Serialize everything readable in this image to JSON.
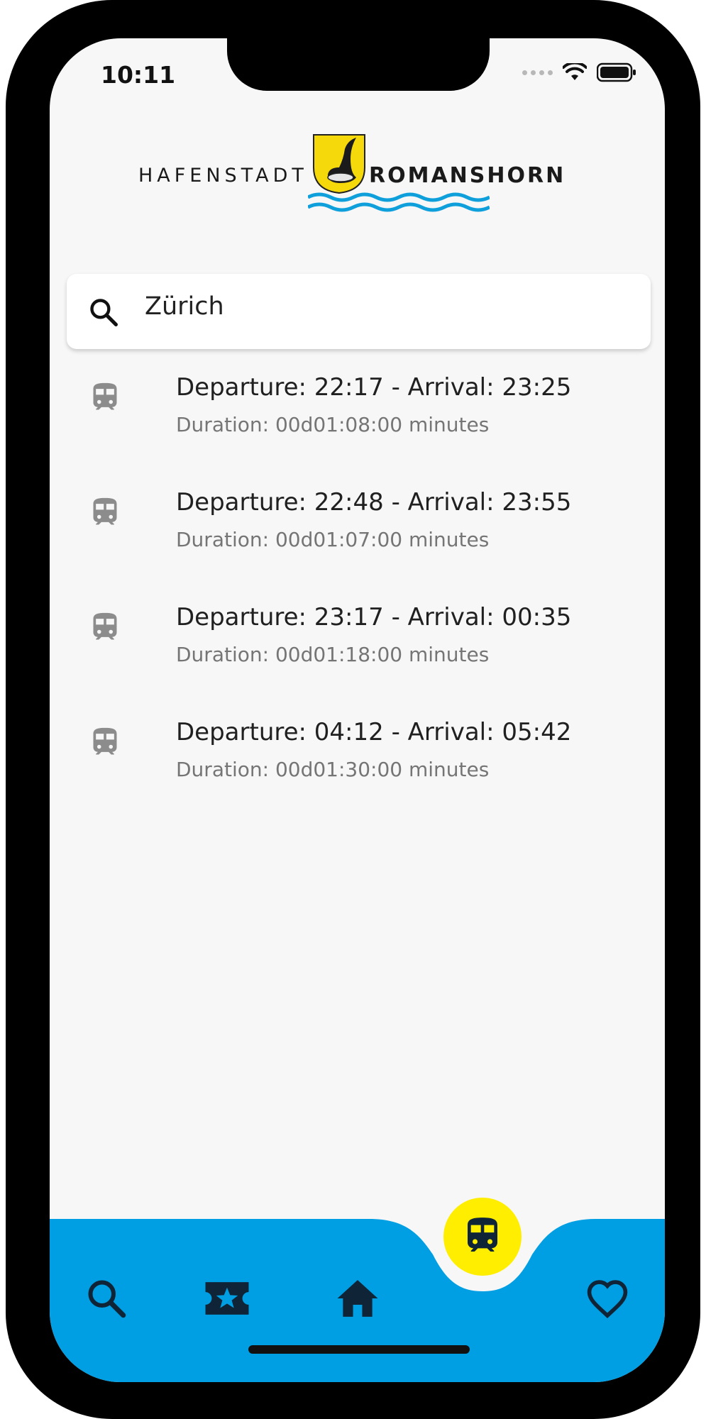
{
  "status_bar": {
    "time": "10:11"
  },
  "logo": {
    "left_text": "HAFENSTADT",
    "right_text": "ROMANSHORN",
    "crest_color": "#f5d90a",
    "wave_color": "#0fa0dc"
  },
  "search": {
    "value": "Zürich",
    "icon": "search-icon"
  },
  "results": [
    {
      "title": "Departure: 22:17 - Arrival: 23:25",
      "subtitle": "Duration: 00d01:08:00 minutes",
      "icon": "train-icon"
    },
    {
      "title": "Departure: 22:48 - Arrival: 23:55",
      "subtitle": "Duration: 00d01:07:00 minutes",
      "icon": "train-icon"
    },
    {
      "title": "Departure: 23:17 - Arrival: 00:35",
      "subtitle": "Duration: 00d01:18:00 minutes",
      "icon": "train-icon"
    },
    {
      "title": "Departure: 04:12 - Arrival: 05:42",
      "subtitle": "Duration: 00d01:30:00 minutes",
      "icon": "train-icon"
    }
  ],
  "bottom_nav": {
    "items": [
      {
        "icon": "search-icon"
      },
      {
        "icon": "ticket-star-icon"
      },
      {
        "icon": "home-icon"
      },
      {
        "icon": "train-icon",
        "active": true
      },
      {
        "icon": "heart-icon"
      }
    ],
    "bar_color": "#009fe3",
    "active_color": "#ffee00",
    "icon_color": "#0f2537"
  },
  "colors": {
    "background": "#f7f7f7",
    "title_text": "#202020",
    "subtitle_text": "#757575",
    "list_icon": "#8c8c8c"
  }
}
